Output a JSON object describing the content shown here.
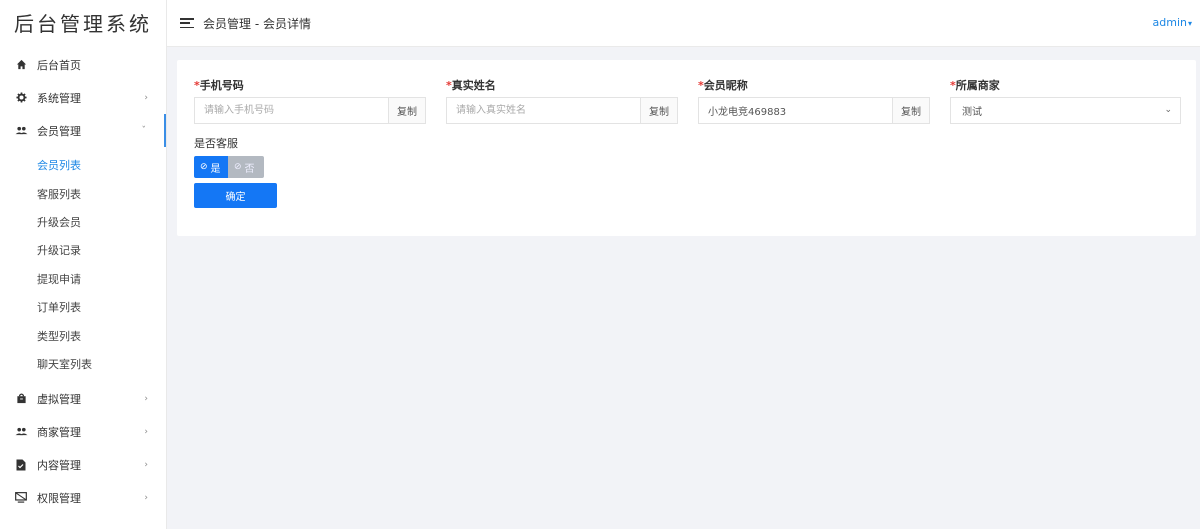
{
  "sidebar": {
    "logo": "后台管理系统",
    "items": [
      {
        "label": "后台首页",
        "icon": "home-icon",
        "chevron": ""
      },
      {
        "label": "系统管理",
        "icon": "gear-icon",
        "chevron": "›"
      },
      {
        "label": "会员管理",
        "icon": "users-icon",
        "chevron": "ˇ"
      }
    ],
    "submenu": [
      {
        "label": "会员列表"
      },
      {
        "label": "客服列表"
      },
      {
        "label": "升级会员"
      },
      {
        "label": "升级记录"
      },
      {
        "label": "提现申请"
      },
      {
        "label": "订单列表"
      },
      {
        "label": "类型列表"
      },
      {
        "label": "聊天室列表"
      }
    ],
    "items_after": [
      {
        "label": "虚拟管理",
        "icon": "bag-icon",
        "chevron": "›"
      },
      {
        "label": "商家管理",
        "icon": "users-icon",
        "chevron": "›"
      },
      {
        "label": "内容管理",
        "icon": "document-icon",
        "chevron": "›"
      },
      {
        "label": "权限管理",
        "icon": "monitor-icon",
        "chevron": "›"
      }
    ]
  },
  "header": {
    "breadcrumb": "会员管理 - 会员详情",
    "user": "admin",
    "caret": "▾"
  },
  "form": {
    "fields": [
      {
        "required": "*",
        "label": "手机号码",
        "placeholder": "请输入手机号码",
        "value": "",
        "copy": "复制"
      },
      {
        "required": "*",
        "label": "真实姓名",
        "placeholder": "请输入真实姓名",
        "value": "",
        "copy": "复制"
      },
      {
        "required": "*",
        "label": "会员昵称",
        "placeholder": "",
        "value": "小龙电竞469883",
        "copy": "复制"
      }
    ],
    "merchant": {
      "required": "*",
      "label": "所属商家",
      "value": "测试",
      "arrow": "⌄"
    },
    "service": {
      "label": "是否客服",
      "yes_icon": "⊘",
      "yes": "是",
      "no_icon": "⊘",
      "no": "否"
    },
    "confirm": "确定"
  }
}
